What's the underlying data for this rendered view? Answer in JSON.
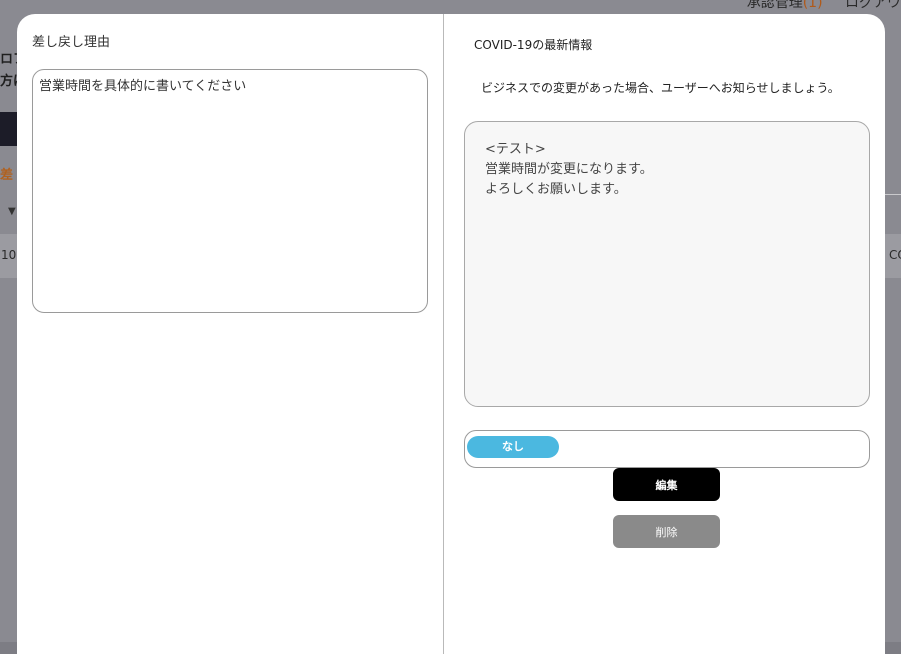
{
  "background": {
    "topnav_text": "承認管理",
    "topnav_badge": "(1)",
    "topnav_extra": "ログアウ",
    "left_fragment_1": "ロフ",
    "left_fragment_2": "方は",
    "orange_fragment": "差",
    "row_left": "10:",
    "row_right": "CO"
  },
  "modal": {
    "left": {
      "title": "差し戻し理由",
      "reason_text": "営業時間を具体的に書いてください"
    },
    "right": {
      "title": "COVID-19の最新情報",
      "description": "ビジネスでの変更があった場合、ユーザーへお知らせしましょう。",
      "content_lines": [
        "<テスト>",
        "営業時間が変更になります。",
        "よろしくお願いします。"
      ],
      "toggle_label": "なし",
      "edit_button": "編集",
      "delete_button": "削除"
    }
  },
  "colors": {
    "toggle": "#4bb8e0",
    "edit_button": "#000000",
    "delete_button": "#8a8a8a"
  }
}
